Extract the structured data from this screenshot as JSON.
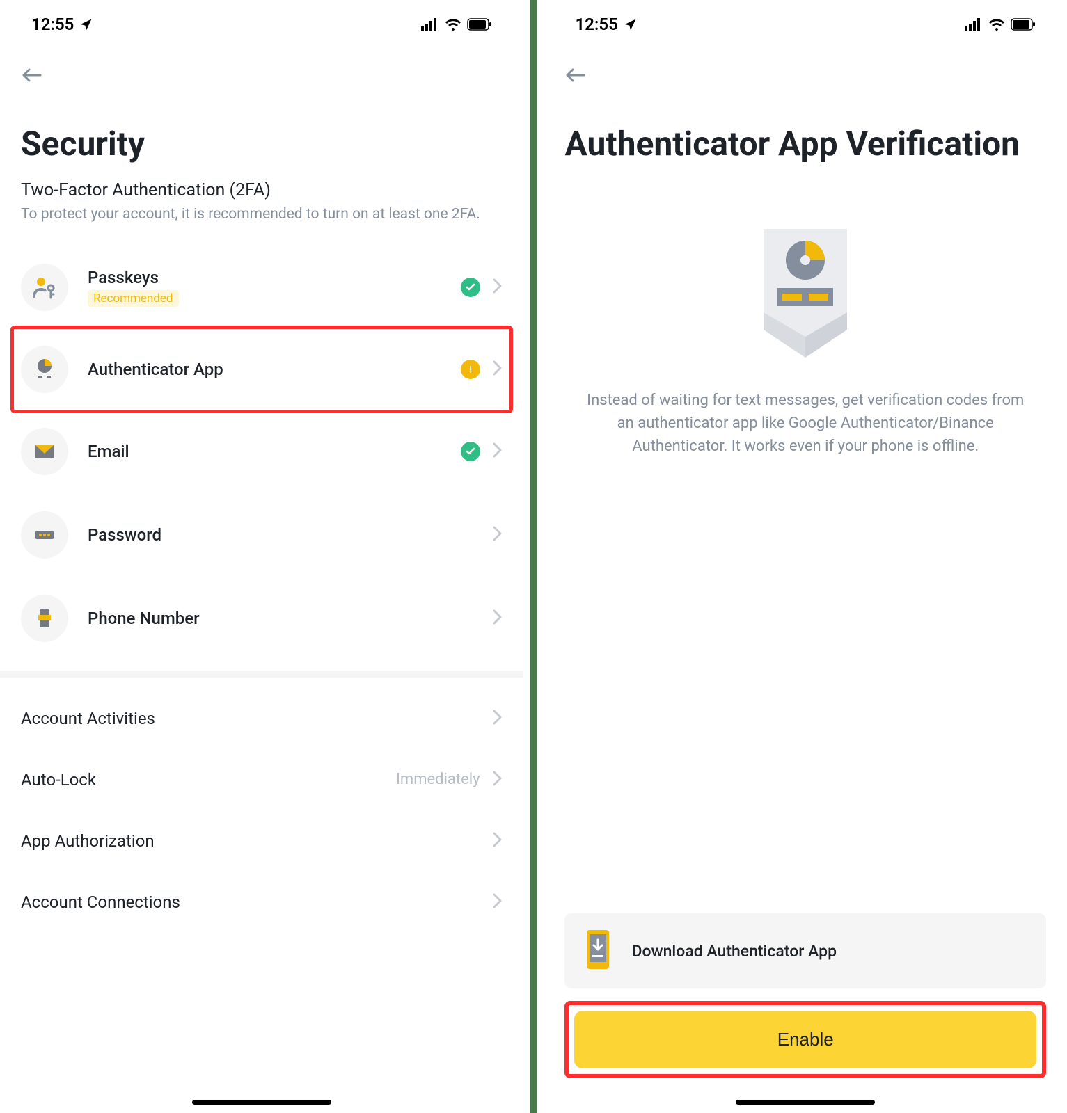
{
  "status": {
    "time": "12:55"
  },
  "left": {
    "title": "Security",
    "section_title": "Two-Factor Authentication (2FA)",
    "section_desc": "To protect your account, it is recommended to turn on at least one 2FA.",
    "items": [
      {
        "label": "Passkeys",
        "badge": "Recommended"
      },
      {
        "label": "Authenticator App"
      },
      {
        "label": "Email"
      },
      {
        "label": "Password"
      },
      {
        "label": "Phone Number"
      }
    ],
    "account_items": [
      {
        "label": "Account Activities"
      },
      {
        "label": "Auto-Lock",
        "value": "Immediately"
      },
      {
        "label": "App Authorization"
      },
      {
        "label": "Account Connections"
      }
    ]
  },
  "right": {
    "title": "Authenticator App Verification",
    "description": "Instead of waiting for text messages, get verification codes from an authenticator app like Google Authenticator/Binance Authenticator. It works even if your phone is offline.",
    "download_label": "Download Authenticator App",
    "enable_label": "Enable"
  }
}
